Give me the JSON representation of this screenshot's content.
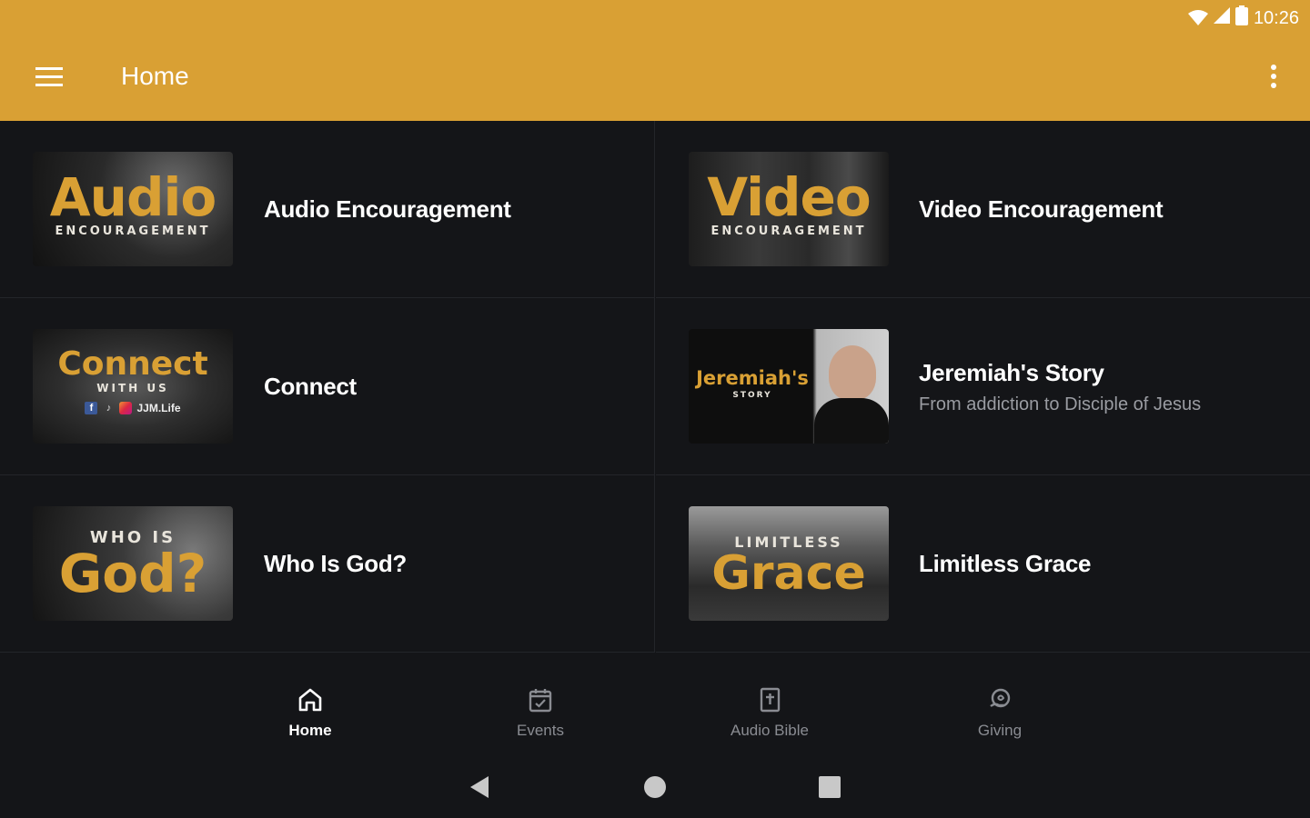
{
  "status": {
    "time": "10:26"
  },
  "header": {
    "title": "Home",
    "menu_icon": "hamburger-icon",
    "more_icon": "more-vert-icon"
  },
  "items": [
    {
      "title": "Audio Encouragement",
      "subtitle": "",
      "thumb": {
        "big": "Audio",
        "small": "ENCOURAGEMENT"
      }
    },
    {
      "title": "Video Encouragement",
      "subtitle": "",
      "thumb": {
        "big": "Video",
        "small": "ENCOURAGEMENT"
      }
    },
    {
      "title": "Connect",
      "subtitle": "",
      "thumb": {
        "big": "Connect",
        "small": "WITH US",
        "handle": "JJM.Life"
      }
    },
    {
      "title": "Jeremiah's Story",
      "subtitle": "From addiction to Disciple of Jesus",
      "thumb": {
        "big": "Jeremiah's",
        "small": "STORY"
      }
    },
    {
      "title": "Who Is God?",
      "subtitle": "",
      "thumb": {
        "big": "God?",
        "small": "WHO IS"
      }
    },
    {
      "title": "Limitless Grace",
      "subtitle": "",
      "thumb": {
        "big": "Grace",
        "small": "LIMITLESS"
      }
    }
  ],
  "bottom_nav": [
    {
      "label": "Home",
      "icon": "home-icon",
      "active": true
    },
    {
      "label": "Events",
      "icon": "calendar-icon",
      "active": false
    },
    {
      "label": "Audio Bible",
      "icon": "bible-icon",
      "active": false
    },
    {
      "label": "Giving",
      "icon": "giving-icon",
      "active": false
    }
  ],
  "colors": {
    "accent": "#d9a034",
    "background": "#141518"
  }
}
